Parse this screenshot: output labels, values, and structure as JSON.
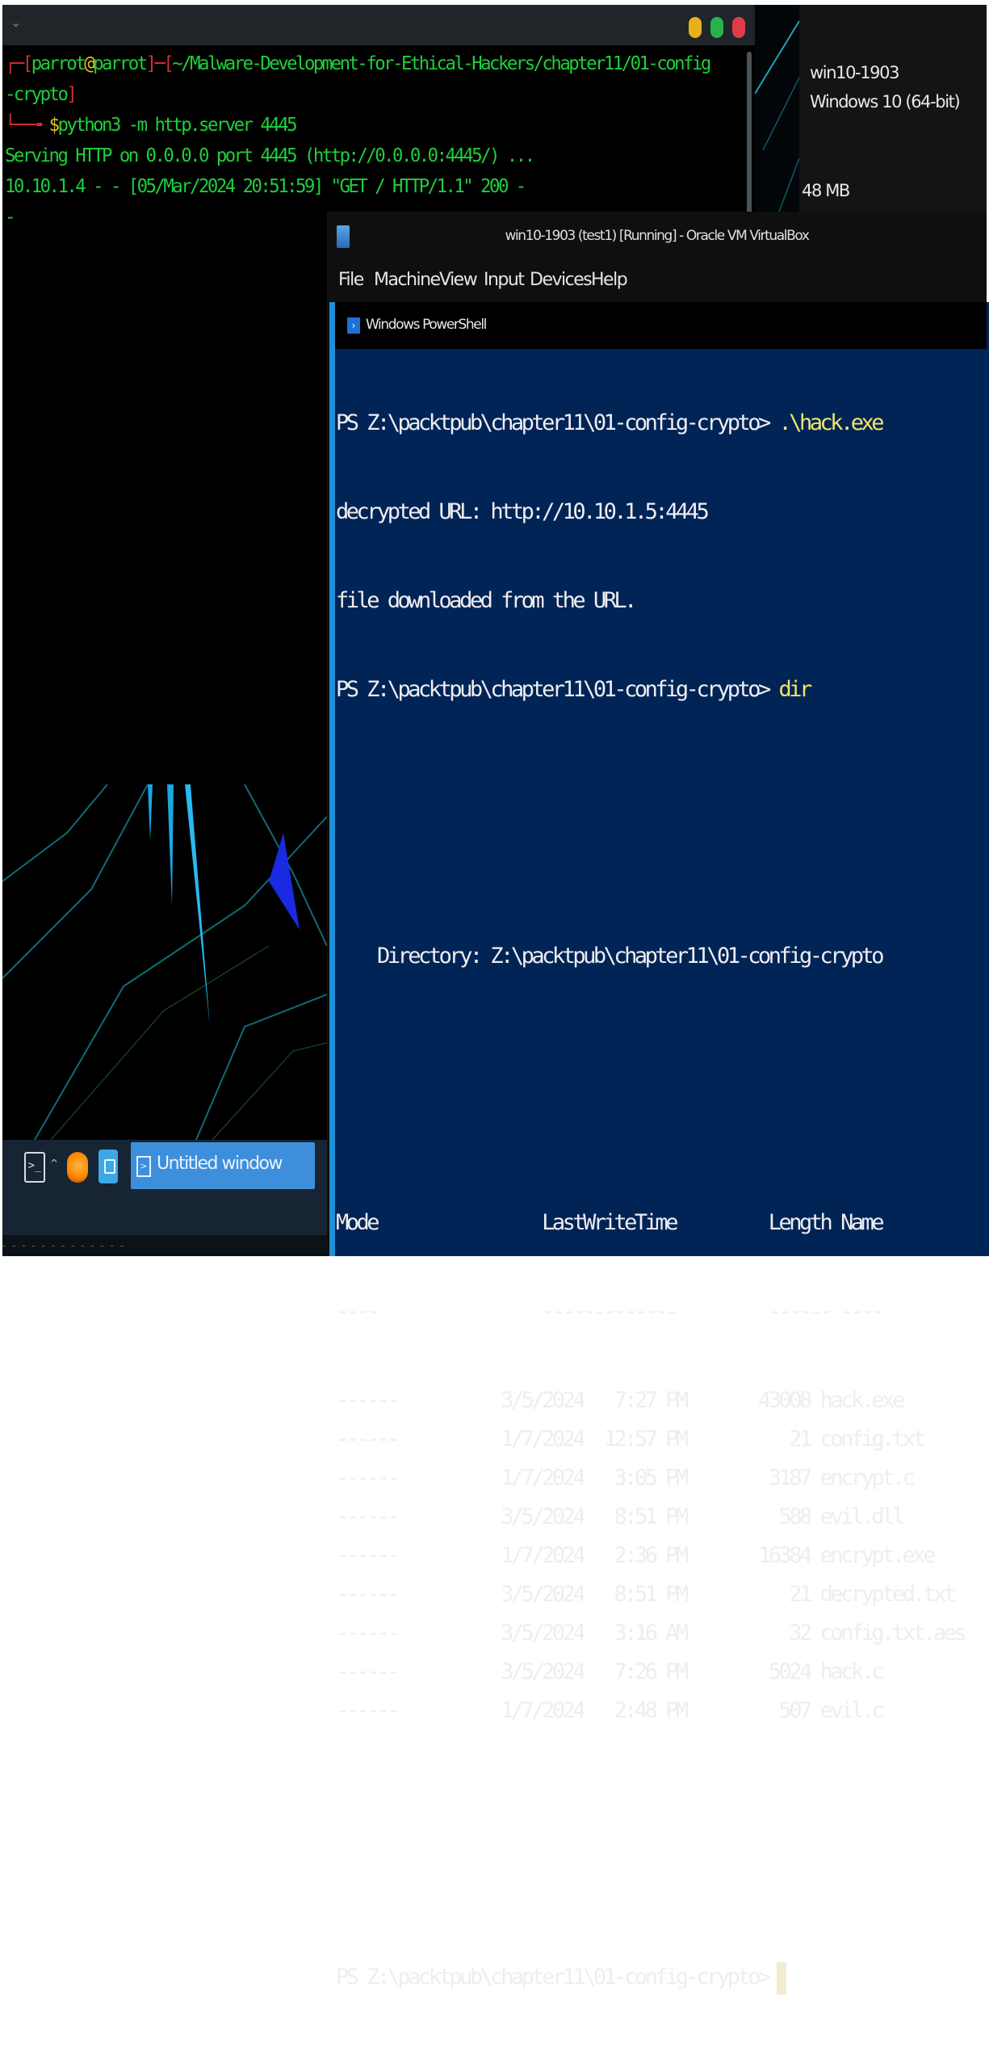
{
  "terminal": {
    "prompt_user": "parrot",
    "prompt_at": "@",
    "prompt_host": "parrot",
    "prompt_path_line1": "~/Malware-Development-for-Ethical-Hackers/chapter11/01-config",
    "prompt_path_line2": "-crypto",
    "prompt_symbol": "$",
    "command": "python3 -m http.server 4445",
    "output": [
      "Serving HTTP on 0.0.0.0 port 4445 (http://0.0.0.0:4445/) ...",
      "10.10.1.4 - - [05/Mar/2024 20:51:59] \"GET / HTTP/1.1\" 200 -"
    ],
    "cursor": "-"
  },
  "vbox_manager": {
    "vm_name": "win10-1903",
    "vm_os": "Windows 10 (64-bit)",
    "vm_memory": "48 MB"
  },
  "vm_window": {
    "title": "win10-1903 (test1) [Running] - Oracle VM VirtualBox",
    "menu": [
      "File",
      "Machine",
      "View",
      "Input",
      "Devices",
      "Help"
    ]
  },
  "powershell": {
    "title": "Windows PowerShell",
    "prompt": "PS Z:\\packtpub\\chapter11\\01-config-crypto>",
    "command1": ".\\hack.exe",
    "output1": "decrypted URL: http://10.10.1.5:4445",
    "output2": "file downloaded from the URL.",
    "command2": "dir",
    "directory_label": "Directory: Z:\\packtpub\\chapter11\\01-config-crypto",
    "headers": {
      "mode": "Mode",
      "lastwritetime": "LastWriteTime",
      "length": "Length",
      "name": "Name"
    },
    "underlines": {
      "mode": "----",
      "lastwritetime": "-------------",
      "length": "------",
      "name": "----"
    },
    "files": [
      {
        "mode": "------",
        "date": "3/5/2024",
        "time": "7:27 PM",
        "length": "43008",
        "name": "hack.exe"
      },
      {
        "mode": "------",
        "date": "1/7/2024",
        "time": "12:57 PM",
        "length": "21",
        "name": "config.txt"
      },
      {
        "mode": "------",
        "date": "1/7/2024",
        "time": "3:05 PM",
        "length": "3187",
        "name": "encrypt.c"
      },
      {
        "mode": "------",
        "date": "3/5/2024",
        "time": "8:51 PM",
        "length": "588",
        "name": "evil.dll"
      },
      {
        "mode": "------",
        "date": "1/7/2024",
        "time": "2:36 PM",
        "length": "16384",
        "name": "encrypt.exe"
      },
      {
        "mode": "------",
        "date": "3/5/2024",
        "time": "8:51 PM",
        "length": "21",
        "name": "decrypted.txt"
      },
      {
        "mode": "------",
        "date": "3/5/2024",
        "time": "3:16 AM",
        "length": "32",
        "name": "config.txt.aes"
      },
      {
        "mode": "------",
        "date": "3/5/2024",
        "time": "7:26 PM",
        "length": "5024",
        "name": "hack.c"
      },
      {
        "mode": "------",
        "date": "1/7/2024",
        "time": "2:48 PM",
        "length": "507",
        "name": "evil.c"
      }
    ]
  },
  "taskbar": {
    "window_label": "Untitled window",
    "bottom_status": "- - - -     - - - - -     - - - -"
  }
}
